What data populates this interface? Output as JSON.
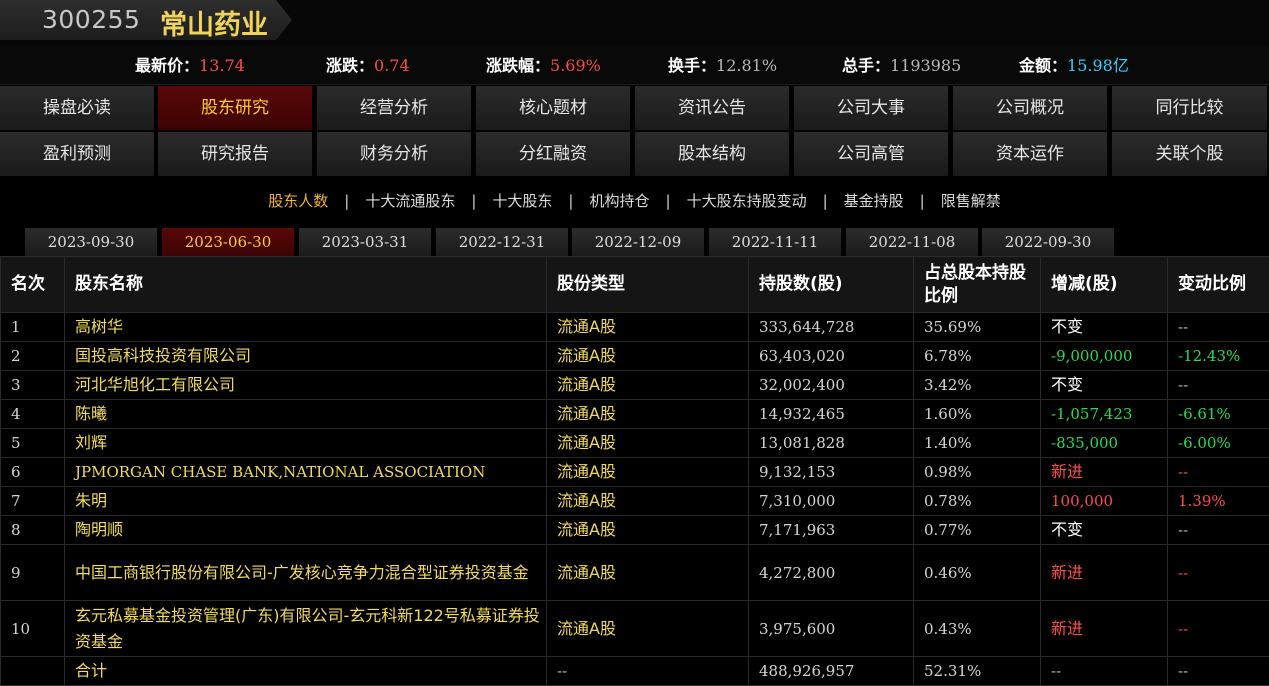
{
  "header": {
    "code": "300255",
    "name": "常山药业"
  },
  "quote": {
    "price_label": "最新价：",
    "price": "13.74",
    "change_label": "涨跌：",
    "change": "0.74",
    "pct_label": "涨跌幅：",
    "pct": "5.69%",
    "turnover_label": "换手：",
    "turnover": "12.81%",
    "volume_label": "总手：",
    "volume": "1193985",
    "amount_label": "金额：",
    "amount": "15.98亿"
  },
  "nav_row1": [
    "操盘必读",
    "股东研究",
    "经营分析",
    "核心题材",
    "资讯公告",
    "公司大事",
    "公司概况",
    "同行比较"
  ],
  "nav_row2": [
    "盈利预测",
    "研究报告",
    "财务分析",
    "分红融资",
    "股本结构",
    "公司高管",
    "资本运作",
    "关联个股"
  ],
  "nav_active": "股东研究",
  "subnav": [
    "股东人数",
    "十大流通股东",
    "十大股东",
    "机构持仓",
    "十大股东持股变动",
    "基金持股",
    "限售解禁"
  ],
  "subnav_sep": "|",
  "dates": [
    "2023-09-30",
    "2023-06-30",
    "2023-03-31",
    "2022-12-31",
    "2022-12-09",
    "2022-11-11",
    "2022-11-08",
    "2022-09-30"
  ],
  "date_active": "2023-06-30",
  "table": {
    "headers": [
      "名次",
      "股东名称",
      "股份类型",
      "持股数(股)",
      "占总股本持股比例",
      "增减(股)",
      "变动比例"
    ],
    "rows": [
      {
        "rank": "1",
        "name": "高树华",
        "type": "流通A股",
        "shares": "333,644,728",
        "ratio": "35.69%",
        "change": "不变",
        "change_pct": "--"
      },
      {
        "rank": "2",
        "name": "国投高科技投资有限公司",
        "type": "流通A股",
        "shares": "63,403,020",
        "ratio": "6.78%",
        "change": "-9,000,000",
        "change_pct": "-12.43%"
      },
      {
        "rank": "3",
        "name": "河北华旭化工有限公司",
        "type": "流通A股",
        "shares": "32,002,400",
        "ratio": "3.42%",
        "change": "不变",
        "change_pct": "--"
      },
      {
        "rank": "4",
        "name": "陈曦",
        "type": "流通A股",
        "shares": "14,932,465",
        "ratio": "1.60%",
        "change": "-1,057,423",
        "change_pct": "-6.61%"
      },
      {
        "rank": "5",
        "name": "刘辉",
        "type": "流通A股",
        "shares": "13,081,828",
        "ratio": "1.40%",
        "change": "-835,000",
        "change_pct": "-6.00%"
      },
      {
        "rank": "6",
        "name": "JPMORGAN CHASE BANK,NATIONAL ASSOCIATION",
        "type": "流通A股",
        "shares": "9,132,153",
        "ratio": "0.98%",
        "change": "新进",
        "change_pct": "--"
      },
      {
        "rank": "7",
        "name": "朱明",
        "type": "流通A股",
        "shares": "7,310,000",
        "ratio": "0.78%",
        "change": "100,000",
        "change_pct": "1.39%"
      },
      {
        "rank": "8",
        "name": "陶明顺",
        "type": "流通A股",
        "shares": "7,171,963",
        "ratio": "0.77%",
        "change": "不变",
        "change_pct": "--"
      },
      {
        "rank": "9",
        "name": "中国工商银行股份有限公司-广发核心竞争力混合型证券投资基金",
        "type": "流通A股",
        "shares": "4,272,800",
        "ratio": "0.46%",
        "change": "新进",
        "change_pct": "--"
      },
      {
        "rank": "10",
        "name": "玄元私募基金投资管理(广东)有限公司-玄元科新122号私募证券投资基金",
        "type": "流通A股",
        "shares": "3,975,600",
        "ratio": "0.43%",
        "change": "新进",
        "change_pct": "--"
      }
    ],
    "total": {
      "rank": "",
      "name": "合计",
      "type": "--",
      "shares": "488,926,957",
      "ratio": "52.31%",
      "change": "--",
      "change_pct": "--"
    }
  }
}
